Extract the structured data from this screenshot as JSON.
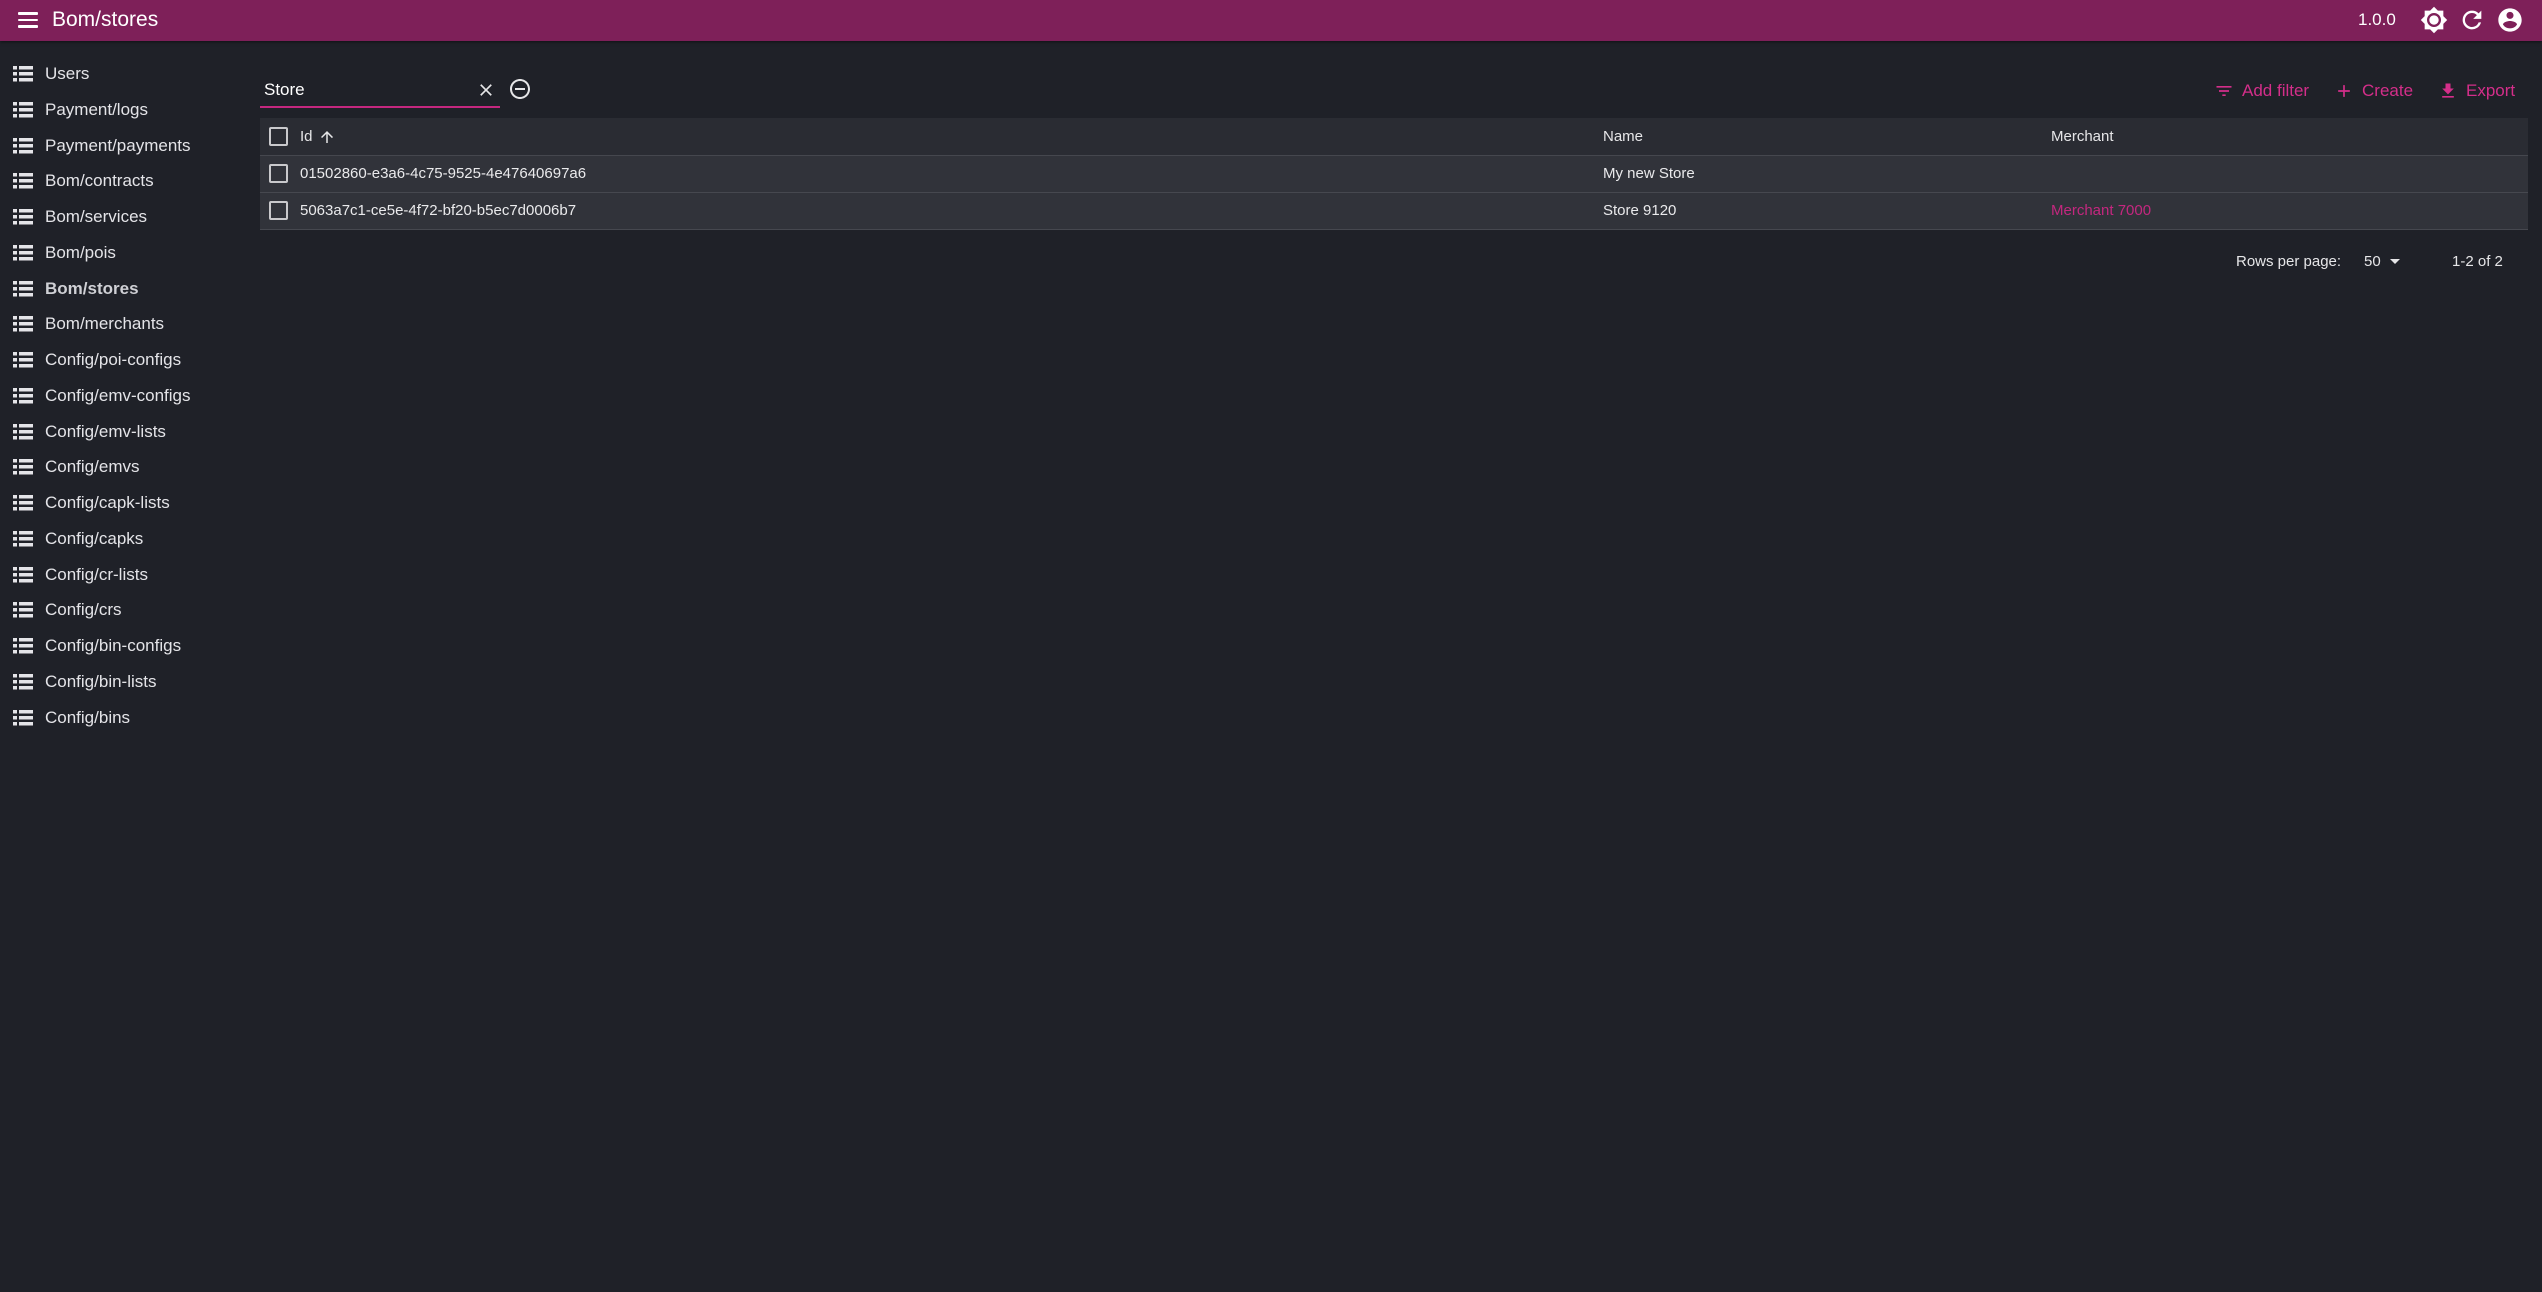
{
  "app_bar": {
    "title": "Bom/stores",
    "version": "1.0.0",
    "icons": [
      "menu-icon",
      "theme-toggle-icon",
      "refresh-icon",
      "account-circle-icon"
    ],
    "background_color": "#7e2059"
  },
  "sidebar": {
    "items": [
      {
        "label": "Users",
        "active": false
      },
      {
        "label": "Payment/logs",
        "active": false
      },
      {
        "label": "Payment/payments",
        "active": false
      },
      {
        "label": "Bom/contracts",
        "active": false
      },
      {
        "label": "Bom/services",
        "active": false
      },
      {
        "label": "Bom/pois",
        "active": false
      },
      {
        "label": "Bom/stores",
        "active": true
      },
      {
        "label": "Bom/merchants",
        "active": false
      },
      {
        "label": "Config/poi-configs",
        "active": false
      },
      {
        "label": "Config/emv-configs",
        "active": false
      },
      {
        "label": "Config/emv-lists",
        "active": false
      },
      {
        "label": "Config/emvs",
        "active": false
      },
      {
        "label": "Config/capk-lists",
        "active": false
      },
      {
        "label": "Config/capks",
        "active": false
      },
      {
        "label": "Config/cr-lists",
        "active": false
      },
      {
        "label": "Config/crs",
        "active": false
      },
      {
        "label": "Config/bin-configs",
        "active": false
      },
      {
        "label": "Config/bin-lists",
        "active": false
      },
      {
        "label": "Config/bins",
        "active": false
      }
    ],
    "item_icon": "list-icon"
  },
  "toolbar": {
    "search_value": "Store",
    "add_filter_label": "Add filter",
    "create_label": "Create",
    "export_label": "Export",
    "accent_color": "#c4277f"
  },
  "table": {
    "columns": [
      "Id",
      "Name",
      "Merchant"
    ],
    "sort": {
      "column": "Id",
      "direction": "ascending"
    },
    "rows": [
      {
        "id": "01502860-e3a6-4c75-9525-4e47640697a6",
        "name": "My new Store",
        "merchant": ""
      },
      {
        "id": "5063a7c1-ce5e-4f72-bf20-b5ec7d0006b7",
        "name": "Store 9120",
        "merchant": "Merchant 7000"
      }
    ]
  },
  "pagination": {
    "rows_per_page_label": "Rows per page:",
    "rows_per_page_value": "50",
    "range_text": "1-2 of 2"
  }
}
